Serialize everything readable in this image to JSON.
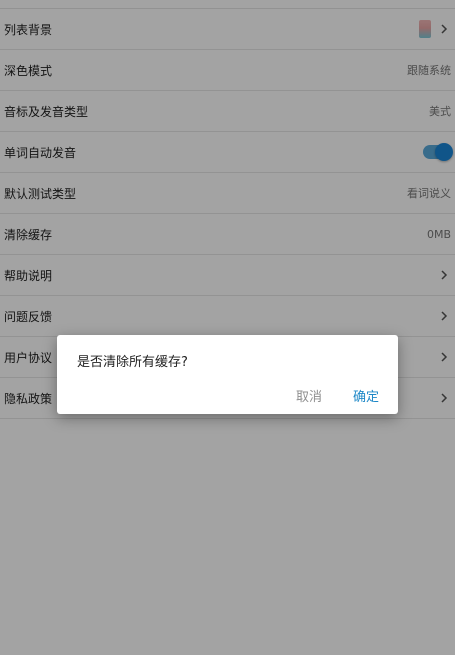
{
  "settings": {
    "list_background": {
      "label": "列表背景"
    },
    "dark_mode": {
      "label": "深色模式",
      "value": "跟随系统"
    },
    "phonetic_type": {
      "label": "音标及发音类型",
      "value": "美式"
    },
    "auto_pronounce": {
      "label": "单词自动发音",
      "enabled": true
    },
    "test_type": {
      "label": "默认测试类型",
      "value": "看词说义"
    },
    "clear_cache": {
      "label": "清除缓存",
      "value": "0MB"
    },
    "help": {
      "label": "帮助说明"
    },
    "feedback": {
      "label": "问题反馈"
    },
    "user_agreement": {
      "label": "用户协议"
    },
    "privacy_policy": {
      "label": "隐私政策"
    }
  },
  "dialog": {
    "message": "是否清除所有缓存?",
    "cancel_label": "取消",
    "confirm_label": "确定"
  },
  "colors": {
    "accent": "#1e88c7",
    "toggle_track": "#5aa9d9",
    "toggle_knob": "#1a85d6"
  },
  "icons": {
    "chevron": "chevron-right-icon"
  }
}
